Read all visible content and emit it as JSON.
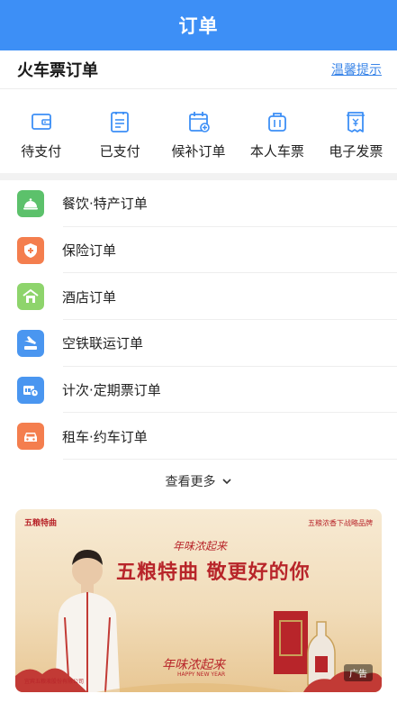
{
  "header": {
    "title": "订单"
  },
  "section": {
    "title": "火车票订单",
    "tip": "温馨提示"
  },
  "ticket_tabs": [
    {
      "label": "待支付",
      "icon": "wallet-icon"
    },
    {
      "label": "已支付",
      "icon": "receipt-icon"
    },
    {
      "label": "候补订单",
      "icon": "calendar-plus-icon"
    },
    {
      "label": "本人车票",
      "icon": "luggage-icon"
    },
    {
      "label": "电子发票",
      "icon": "invoice-icon"
    }
  ],
  "orders": [
    {
      "label": "餐饮·特产订单",
      "icon": "dining-bell-icon",
      "color": "#5cc16b"
    },
    {
      "label": "保险订单",
      "icon": "shield-plus-icon",
      "color": "#f47e4e"
    },
    {
      "label": "酒店订单",
      "icon": "hotel-icon",
      "color": "#8ed46c"
    },
    {
      "label": "空铁联运订单",
      "icon": "plane-train-icon",
      "color": "#4a96f0"
    },
    {
      "label": "计次·定期票订单",
      "icon": "ticket-pass-icon",
      "color": "#4a96f0"
    },
    {
      "label": "租车·约车订单",
      "icon": "car-icon",
      "color": "#f47e4e"
    }
  ],
  "more": {
    "label": "查看更多"
  },
  "banner": {
    "logo": "五粮特曲",
    "top_right": "五粮浓香下战略品牌",
    "subtitle": "年味浓起来",
    "headline": "五粮特曲 敬更好的你",
    "bottom_script": "年味浓起来",
    "bottom_en": "HAPPY NEW YEAR",
    "company": "宜宾五粮液股份有限公司",
    "ad_badge": "广告"
  },
  "colors": {
    "brand": "#3d8ff6",
    "link": "#3a85e8"
  }
}
